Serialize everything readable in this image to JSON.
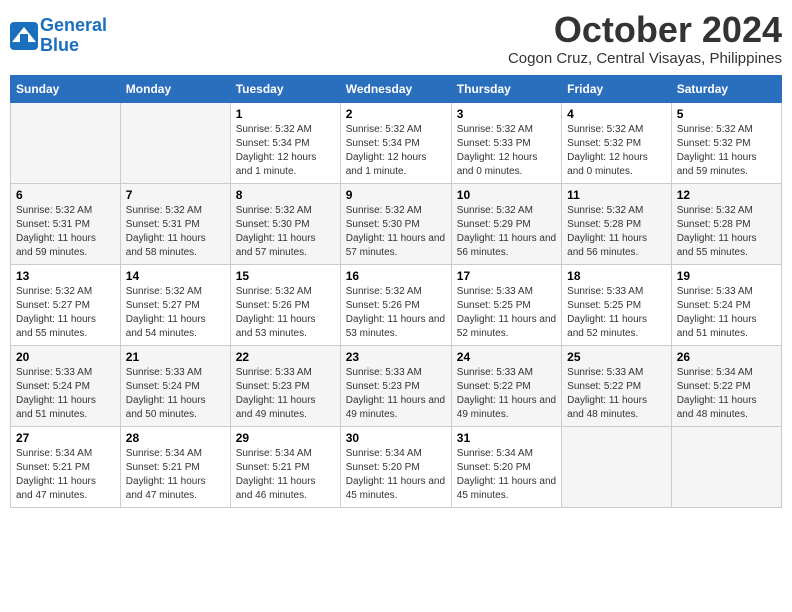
{
  "header": {
    "logo_line1": "General",
    "logo_line2": "Blue",
    "month_title": "October 2024",
    "location": "Cogon Cruz, Central Visayas, Philippines"
  },
  "weekdays": [
    "Sunday",
    "Monday",
    "Tuesday",
    "Wednesday",
    "Thursday",
    "Friday",
    "Saturday"
  ],
  "weeks": [
    [
      {
        "day": "",
        "info": ""
      },
      {
        "day": "",
        "info": ""
      },
      {
        "day": "1",
        "info": "Sunrise: 5:32 AM\nSunset: 5:34 PM\nDaylight: 12 hours and 1 minute."
      },
      {
        "day": "2",
        "info": "Sunrise: 5:32 AM\nSunset: 5:34 PM\nDaylight: 12 hours and 1 minute."
      },
      {
        "day": "3",
        "info": "Sunrise: 5:32 AM\nSunset: 5:33 PM\nDaylight: 12 hours and 0 minutes."
      },
      {
        "day": "4",
        "info": "Sunrise: 5:32 AM\nSunset: 5:32 PM\nDaylight: 12 hours and 0 minutes."
      },
      {
        "day": "5",
        "info": "Sunrise: 5:32 AM\nSunset: 5:32 PM\nDaylight: 11 hours and 59 minutes."
      }
    ],
    [
      {
        "day": "6",
        "info": "Sunrise: 5:32 AM\nSunset: 5:31 PM\nDaylight: 11 hours and 59 minutes."
      },
      {
        "day": "7",
        "info": "Sunrise: 5:32 AM\nSunset: 5:31 PM\nDaylight: 11 hours and 58 minutes."
      },
      {
        "day": "8",
        "info": "Sunrise: 5:32 AM\nSunset: 5:30 PM\nDaylight: 11 hours and 57 minutes."
      },
      {
        "day": "9",
        "info": "Sunrise: 5:32 AM\nSunset: 5:30 PM\nDaylight: 11 hours and 57 minutes."
      },
      {
        "day": "10",
        "info": "Sunrise: 5:32 AM\nSunset: 5:29 PM\nDaylight: 11 hours and 56 minutes."
      },
      {
        "day": "11",
        "info": "Sunrise: 5:32 AM\nSunset: 5:28 PM\nDaylight: 11 hours and 56 minutes."
      },
      {
        "day": "12",
        "info": "Sunrise: 5:32 AM\nSunset: 5:28 PM\nDaylight: 11 hours and 55 minutes."
      }
    ],
    [
      {
        "day": "13",
        "info": "Sunrise: 5:32 AM\nSunset: 5:27 PM\nDaylight: 11 hours and 55 minutes."
      },
      {
        "day": "14",
        "info": "Sunrise: 5:32 AM\nSunset: 5:27 PM\nDaylight: 11 hours and 54 minutes."
      },
      {
        "day": "15",
        "info": "Sunrise: 5:32 AM\nSunset: 5:26 PM\nDaylight: 11 hours and 53 minutes."
      },
      {
        "day": "16",
        "info": "Sunrise: 5:32 AM\nSunset: 5:26 PM\nDaylight: 11 hours and 53 minutes."
      },
      {
        "day": "17",
        "info": "Sunrise: 5:33 AM\nSunset: 5:25 PM\nDaylight: 11 hours and 52 minutes."
      },
      {
        "day": "18",
        "info": "Sunrise: 5:33 AM\nSunset: 5:25 PM\nDaylight: 11 hours and 52 minutes."
      },
      {
        "day": "19",
        "info": "Sunrise: 5:33 AM\nSunset: 5:24 PM\nDaylight: 11 hours and 51 minutes."
      }
    ],
    [
      {
        "day": "20",
        "info": "Sunrise: 5:33 AM\nSunset: 5:24 PM\nDaylight: 11 hours and 51 minutes."
      },
      {
        "day": "21",
        "info": "Sunrise: 5:33 AM\nSunset: 5:24 PM\nDaylight: 11 hours and 50 minutes."
      },
      {
        "day": "22",
        "info": "Sunrise: 5:33 AM\nSunset: 5:23 PM\nDaylight: 11 hours and 49 minutes."
      },
      {
        "day": "23",
        "info": "Sunrise: 5:33 AM\nSunset: 5:23 PM\nDaylight: 11 hours and 49 minutes."
      },
      {
        "day": "24",
        "info": "Sunrise: 5:33 AM\nSunset: 5:22 PM\nDaylight: 11 hours and 49 minutes."
      },
      {
        "day": "25",
        "info": "Sunrise: 5:33 AM\nSunset: 5:22 PM\nDaylight: 11 hours and 48 minutes."
      },
      {
        "day": "26",
        "info": "Sunrise: 5:34 AM\nSunset: 5:22 PM\nDaylight: 11 hours and 48 minutes."
      }
    ],
    [
      {
        "day": "27",
        "info": "Sunrise: 5:34 AM\nSunset: 5:21 PM\nDaylight: 11 hours and 47 minutes."
      },
      {
        "day": "28",
        "info": "Sunrise: 5:34 AM\nSunset: 5:21 PM\nDaylight: 11 hours and 47 minutes."
      },
      {
        "day": "29",
        "info": "Sunrise: 5:34 AM\nSunset: 5:21 PM\nDaylight: 11 hours and 46 minutes."
      },
      {
        "day": "30",
        "info": "Sunrise: 5:34 AM\nSunset: 5:20 PM\nDaylight: 11 hours and 45 minutes."
      },
      {
        "day": "31",
        "info": "Sunrise: 5:34 AM\nSunset: 5:20 PM\nDaylight: 11 hours and 45 minutes."
      },
      {
        "day": "",
        "info": ""
      },
      {
        "day": "",
        "info": ""
      }
    ]
  ]
}
